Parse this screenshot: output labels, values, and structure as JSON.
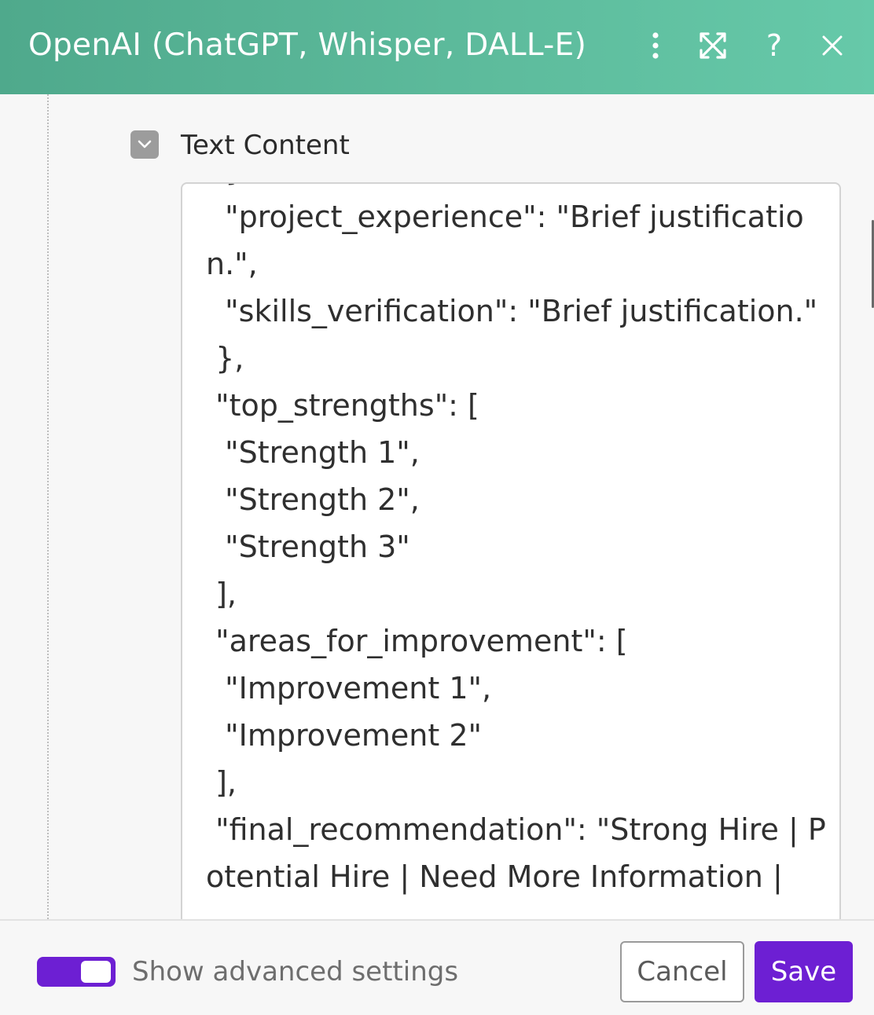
{
  "header": {
    "title": "OpenAI (ChatGPT, Whisper, DALL-E)",
    "icons": [
      "more-vertical-icon",
      "expand-icon",
      "help-icon",
      "close-icon"
    ],
    "help_glyph": "?",
    "background_colors": [
      "#4fa98c",
      "#66c9a9"
    ]
  },
  "field": {
    "label": "Text Content",
    "collapse_icon": "chevron-down-icon",
    "value_visible": "  },\n  \"project_experience\": \"Brief justification.\",\n  \"skills_verification\": \"Brief justification.\"\n },\n \"top_strengths\": [\n  \"Strength 1\",\n  \"Strength 2\",\n  \"Strength 3\"\n ],\n \"areas_for_improvement\": [\n  \"Improvement 1\",\n  \"Improvement 2\"\n ],\n \"final_recommendation\": \"Strong Hire | Potential Hire | Need More Information |"
  },
  "footer": {
    "advanced_toggle_label": "Show advanced settings",
    "advanced_toggle_on": true,
    "cancel_label": "Cancel",
    "save_label": "Save",
    "accent_color": "#6d1fd3"
  }
}
